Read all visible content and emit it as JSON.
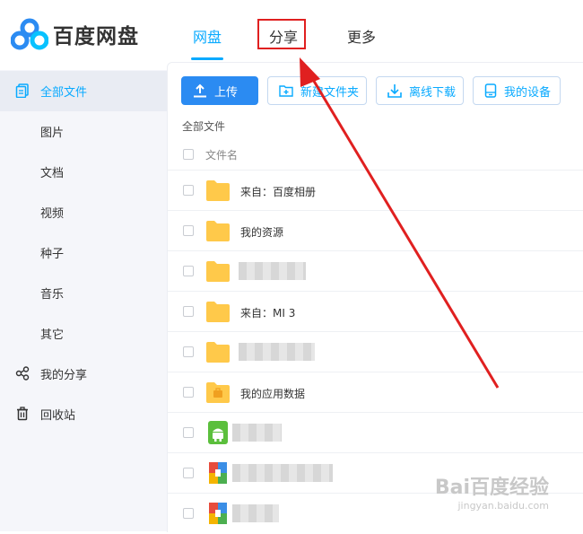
{
  "app": {
    "name": "百度网盘"
  },
  "nav": {
    "tabs": [
      {
        "label": "网盘",
        "active": true
      },
      {
        "label": "分享",
        "active": false
      },
      {
        "label": "更多",
        "active": false
      }
    ]
  },
  "sidebar": {
    "items": [
      {
        "label": "全部文件",
        "icon": "document-icon",
        "active": true
      },
      {
        "label": "图片",
        "icon": "",
        "active": false
      },
      {
        "label": "文档",
        "icon": "",
        "active": false
      },
      {
        "label": "视频",
        "icon": "",
        "active": false
      },
      {
        "label": "种子",
        "icon": "",
        "active": false
      },
      {
        "label": "音乐",
        "icon": "",
        "active": false
      },
      {
        "label": "其它",
        "icon": "",
        "active": false
      },
      {
        "label": "我的分享",
        "icon": "share-icon",
        "active": false
      },
      {
        "label": "回收站",
        "icon": "trash-icon",
        "active": false
      }
    ]
  },
  "toolbar": {
    "upload_label": "上传",
    "new_folder_label": "新建文件夹",
    "offline_download_label": "离线下载",
    "my_devices_label": "我的设备"
  },
  "breadcrumb": "全部文件",
  "table": {
    "column_name": "文件名",
    "rows": [
      {
        "name": "来自：百度相册",
        "type": "folder"
      },
      {
        "name": "我的资源",
        "type": "folder"
      },
      {
        "name": "",
        "type": "folder",
        "blurred": true
      },
      {
        "name": "来自：MI 3",
        "type": "folder"
      },
      {
        "name": "",
        "type": "folder",
        "blurred": true
      },
      {
        "name": "我的应用数据",
        "type": "app-folder"
      },
      {
        "name": "",
        "type": "apk",
        "blurred": true
      },
      {
        "name": "",
        "type": "archive",
        "blurred": true
      },
      {
        "name": "",
        "type": "archive",
        "blurred": true
      }
    ]
  },
  "colors": {
    "accent": "#09aaff",
    "primary_button": "#2b8bf2",
    "highlight": "#e02020",
    "folder": "#ffc94a"
  },
  "watermark": {
    "main": "Bai百度经验",
    "sub": "jingyan.baidu.com"
  }
}
